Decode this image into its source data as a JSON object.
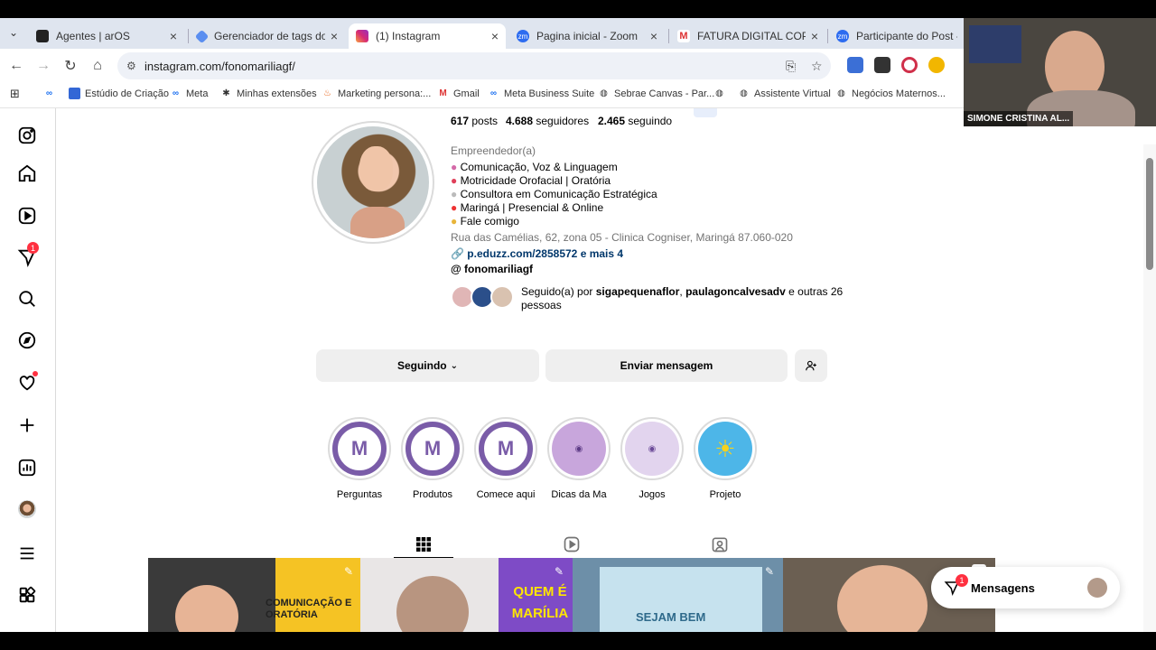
{
  "browser": {
    "tabs": [
      {
        "title": "Agentes | arOS",
        "active": false
      },
      {
        "title": "Gerenciador de tags do Go",
        "active": false
      },
      {
        "title": "(1) Instagram",
        "active": true
      },
      {
        "title": "Pagina inicial - Zoom",
        "active": false
      },
      {
        "title": "FATURA DIGITAL COPEL N",
        "active": false
      },
      {
        "title": "Participante do Post - Zoo",
        "active": false
      }
    ],
    "url": "instagram.com/fonomariliagf/",
    "bookmarks": [
      "Estúdio de Criação",
      "Meta",
      "Minhas extensões",
      "Marketing persona:...",
      "Gmail",
      "Meta Business Suite",
      "Sebrae Canvas - Par...",
      "Assistente Virtual",
      "Negócios Maternos..."
    ]
  },
  "sidebar": {
    "notification_count": "1"
  },
  "profile": {
    "stats": {
      "posts_count": "617",
      "posts_label": "posts",
      "followers_count": "4.688",
      "followers_label": "seguidores",
      "following_count": "2.465",
      "following_label": "seguindo"
    },
    "category": "Empreendedor(a)",
    "bio_lines": [
      "Comunicação, Voz & Linguagem",
      "Motricidade Orofacial | Oratória",
      "Consultora em Comunicação Estratégica",
      "Maringá | Presencial & Online",
      "Fale comigo"
    ],
    "address": "Rua das Camélias, 62, zona 05 - Clinica Cogniser, Maringá 87.060-020",
    "link": "p.eduzz.com/2858572 e mais 4",
    "threads": "fonomariliagf",
    "followed_by": {
      "prefix": "Seguido(a) por",
      "user1": "sigapequenaflor",
      "user2": "paulagoncalvesadv",
      "suffix": "e outras 26",
      "suffix2": "pessoas"
    },
    "buttons": {
      "following": "Seguindo",
      "message": "Enviar mensagem"
    }
  },
  "highlights": [
    {
      "label": "Perguntas"
    },
    {
      "label": "Produtos"
    },
    {
      "label": "Comece aqui"
    },
    {
      "label": "Dicas da Ma"
    },
    {
      "label": "Jogos"
    },
    {
      "label": "Projeto"
    }
  ],
  "posts": [
    {
      "overlay_text": "COMUNICAÇÃO E ORATÓRIA"
    },
    {
      "overlay_text": "QUEM É MARÍLIA"
    },
    {
      "overlay_text": "SEJAM BEM"
    },
    {
      "overlay_text": ""
    }
  ],
  "video": {
    "participant_name": "SIMONE CRISTINA AL..."
  },
  "messages": {
    "label": "Mensagens",
    "count": "1"
  }
}
